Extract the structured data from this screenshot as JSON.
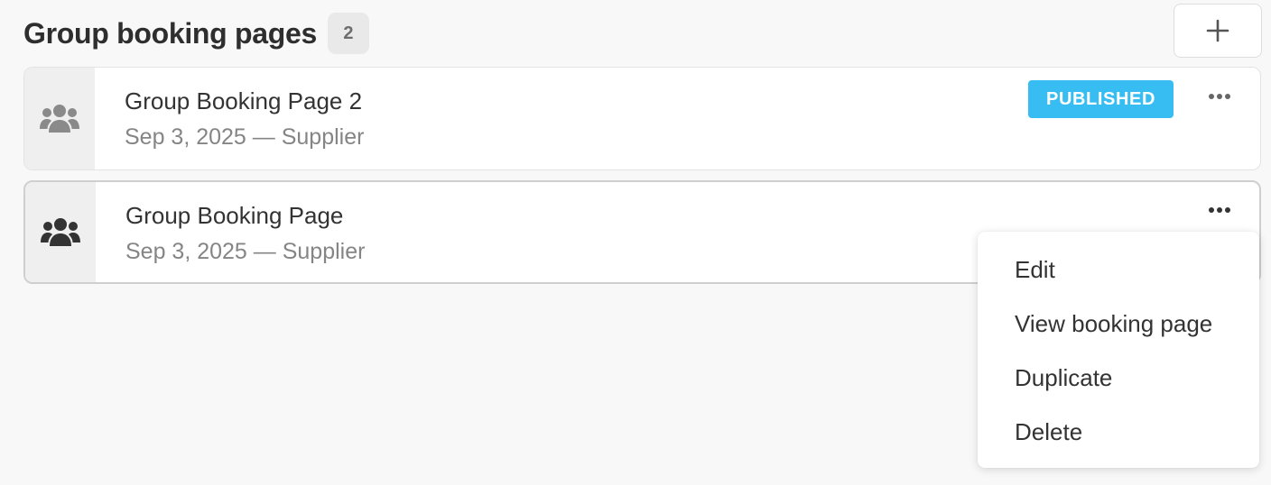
{
  "header": {
    "title": "Group booking pages",
    "count": "2",
    "add_icon": "plus-icon"
  },
  "booking_pages": [
    {
      "title": "Group Booking Page 2",
      "meta": "Sep 3, 2025 — Supplier",
      "status": "PUBLISHED",
      "icon": "group-icon"
    },
    {
      "title": "Group Booking Page",
      "meta": "Sep 3, 2025 — Supplier",
      "icon": "group-icon"
    }
  ],
  "menu": {
    "items": [
      {
        "label": "Edit"
      },
      {
        "label": "View booking page"
      },
      {
        "label": "Duplicate"
      },
      {
        "label": "Delete"
      }
    ]
  },
  "colors": {
    "published_badge": "#38bdf3",
    "icon_muted": "#8a8a8a",
    "icon_dark": "#333333"
  }
}
